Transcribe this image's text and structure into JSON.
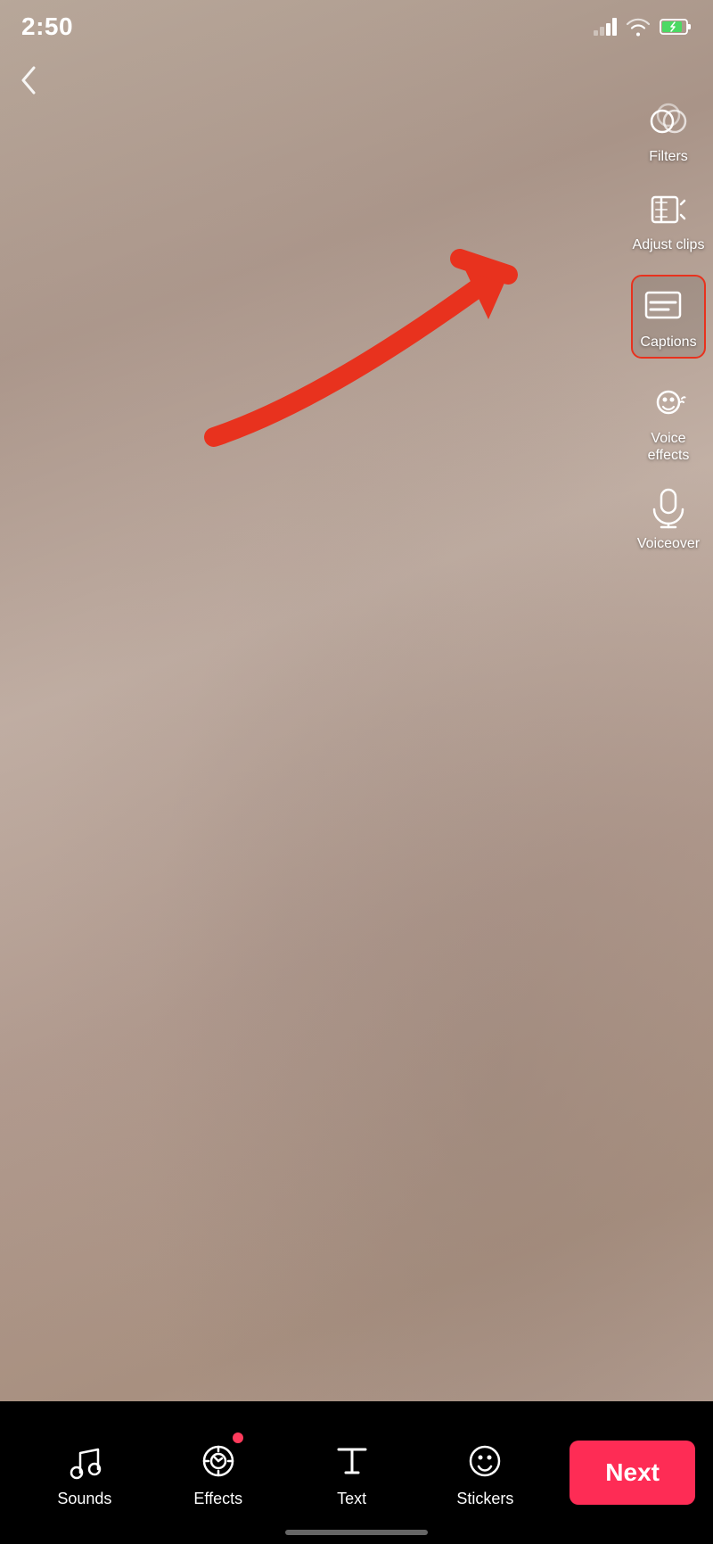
{
  "status_bar": {
    "time": "2:50",
    "signal_label": "signal",
    "wifi_label": "wifi",
    "battery_label": "battery"
  },
  "back_button": {
    "label": "‹",
    "aria": "back"
  },
  "toolbar": {
    "items": [
      {
        "id": "filters",
        "label": "Filters",
        "icon": "filters-icon"
      },
      {
        "id": "adjust-clips",
        "label": "Adjust clips",
        "icon": "adjust-clips-icon"
      },
      {
        "id": "captions",
        "label": "Captions",
        "icon": "captions-icon",
        "highlighted": true
      },
      {
        "id": "voice-effects",
        "label": "Voice effects",
        "icon": "voice-effects-icon"
      },
      {
        "id": "voiceover",
        "label": "Voiceover",
        "icon": "voiceover-icon"
      }
    ]
  },
  "annotation": {
    "arrow_color": "#e8321e"
  },
  "bottom_nav": {
    "items": [
      {
        "id": "sounds",
        "label": "Sounds",
        "icon": "music-icon",
        "has_dot": false
      },
      {
        "id": "effects",
        "label": "Effects",
        "icon": "effects-icon",
        "has_dot": true
      },
      {
        "id": "text",
        "label": "Text",
        "icon": "text-icon",
        "has_dot": false
      },
      {
        "id": "stickers",
        "label": "Stickers",
        "icon": "stickers-icon",
        "has_dot": false
      }
    ],
    "next_button_label": "Next"
  }
}
